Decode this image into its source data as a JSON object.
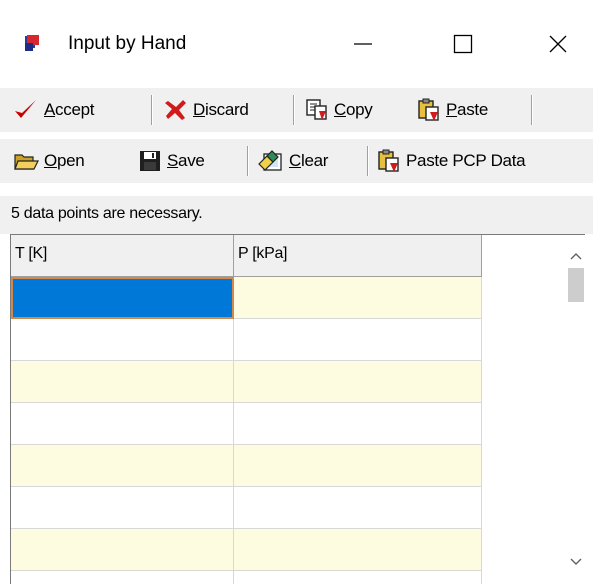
{
  "window": {
    "title": "Input by Hand",
    "icon": "app-icon",
    "controls": [
      "minimize-icon",
      "maximize-icon",
      "close-icon"
    ]
  },
  "toolbar1": {
    "accept": {
      "label": "Accept",
      "mnemonic": "A",
      "icon": "check-icon",
      "color": "#cc0000"
    },
    "discard": {
      "label": "Discard",
      "mnemonic": "D",
      "icon": "x-icon",
      "color": "#d11a1a"
    },
    "copy": {
      "label": "Copy",
      "mnemonic": "C",
      "icon": "copy-icon"
    },
    "paste": {
      "label": "Paste",
      "mnemonic": "P",
      "icon": "paste-icon"
    }
  },
  "toolbar2": {
    "open": {
      "label": "Open",
      "mnemonic": "O",
      "icon": "folder-open-icon"
    },
    "save": {
      "label": "Save",
      "mnemonic": "S",
      "icon": "floppy-disk-icon"
    },
    "clear": {
      "label": "Clear",
      "mnemonic": "C",
      "icon": "clear-icon"
    },
    "paste_pcp": {
      "label": "Paste PCP Data",
      "icon": "paste-icon"
    }
  },
  "status": {
    "message": "5 data points are necessary."
  },
  "grid": {
    "columns": [
      "T [K]",
      "P [kPa]"
    ],
    "rows": [
      [
        "",
        ""
      ],
      [
        "",
        ""
      ],
      [
        "",
        ""
      ],
      [
        "",
        ""
      ],
      [
        "",
        ""
      ],
      [
        "",
        ""
      ],
      [
        "",
        ""
      ],
      [
        "",
        ""
      ]
    ],
    "selected_cell": {
      "row": 0,
      "col": 0
    },
    "colors": {
      "odd_row": "#fdfbe0",
      "even_row": "#ffffff",
      "selection": "#0078d7",
      "selection_border": "#d2894e"
    }
  }
}
